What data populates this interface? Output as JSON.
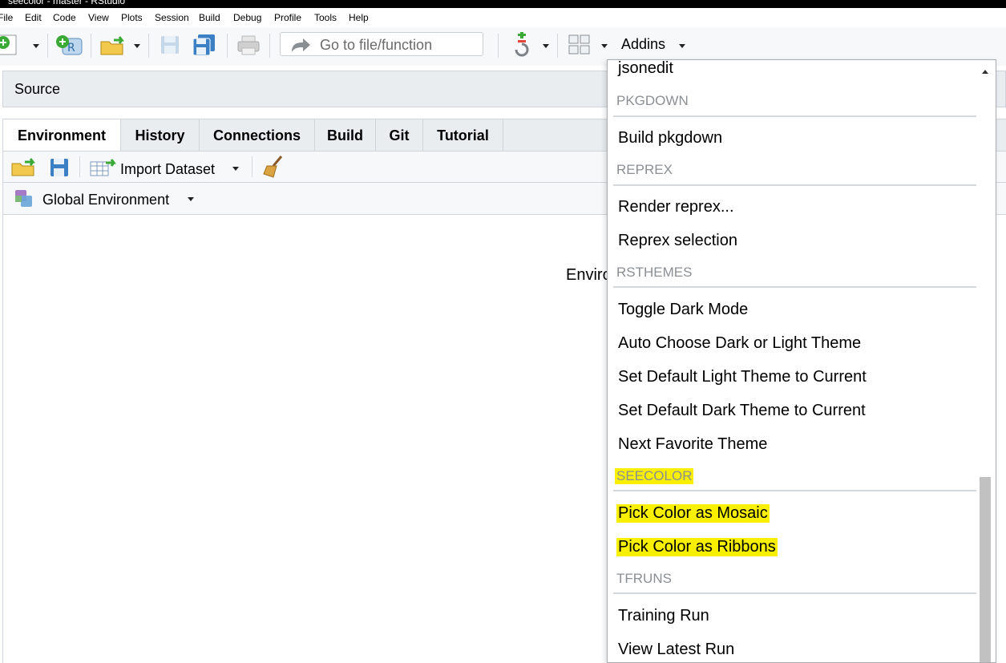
{
  "window": {
    "title": "seecolor - master - RStudio"
  },
  "menubar": [
    "File",
    "Edit",
    "Code",
    "View",
    "Plots",
    "Session",
    "Build",
    "Debug",
    "Profile",
    "Tools",
    "Help"
  ],
  "toolbar": {
    "goto_placeholder": "Go to file/function",
    "addins_label": "Addins"
  },
  "source_pane": {
    "title": "Source"
  },
  "env_pane": {
    "tabs": [
      "Environment",
      "History",
      "Connections",
      "Build",
      "Git",
      "Tutorial"
    ],
    "import_label": "Import Dataset",
    "env_selector": "Global Environment",
    "empty_text": "Enviro"
  },
  "addins_menu": {
    "top_partial_item": "jsonedit",
    "groups": [
      {
        "header": "PKGDOWN",
        "items": [
          "Build pkgdown"
        ]
      },
      {
        "header": "REPREX",
        "items": [
          "Render reprex...",
          "Reprex selection"
        ]
      },
      {
        "header": "RSTHEMES",
        "items": [
          "Toggle Dark Mode",
          "Auto Choose Dark or Light Theme",
          "Set Default Light Theme to Current",
          "Set Default Dark Theme to Current",
          "Next Favorite Theme"
        ]
      },
      {
        "header": "SEECOLOR",
        "items": [
          "Pick Color as Mosaic",
          "Pick Color as Ribbons"
        ]
      },
      {
        "header": "TFRUNS",
        "items": [
          "Training Run",
          "View Latest Run"
        ]
      }
    ],
    "highlight_color": "#f8f000"
  },
  "colors": {
    "accent_green": "#3aa935",
    "folder_yellow": "#f2c94c",
    "save_blue": "#3b7fc4"
  }
}
